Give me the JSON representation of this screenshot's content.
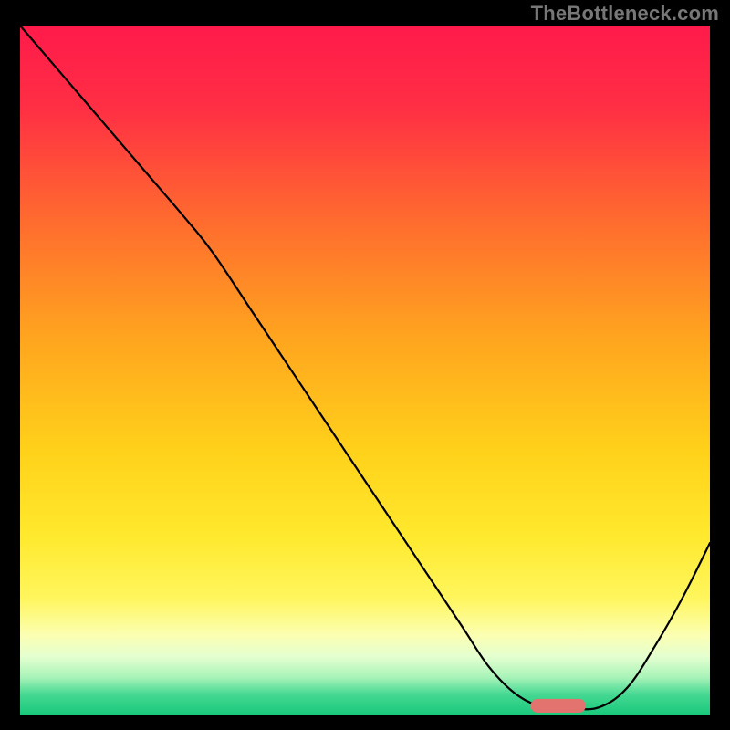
{
  "watermark": "TheBottleneck.com",
  "chart_data": {
    "type": "line",
    "title": "",
    "xlabel": "",
    "ylabel": "",
    "xlim": [
      0,
      100
    ],
    "ylim": [
      0,
      100
    ],
    "background_gradient": {
      "stops": [
        {
          "offset": 0.0,
          "color": "#ff1a4b"
        },
        {
          "offset": 0.12,
          "color": "#ff2f44"
        },
        {
          "offset": 0.28,
          "color": "#ff6a2f"
        },
        {
          "offset": 0.45,
          "color": "#ffa41f"
        },
        {
          "offset": 0.62,
          "color": "#ffd21a"
        },
        {
          "offset": 0.74,
          "color": "#ffe92e"
        },
        {
          "offset": 0.83,
          "color": "#fff65e"
        },
        {
          "offset": 0.885,
          "color": "#fbffb3"
        },
        {
          "offset": 0.915,
          "color": "#e4ffd0"
        },
        {
          "offset": 0.945,
          "color": "#a8f3b8"
        },
        {
          "offset": 0.97,
          "color": "#44d892"
        },
        {
          "offset": 1.0,
          "color": "#18c87a"
        }
      ]
    },
    "series": [
      {
        "name": "bottleneck-curve",
        "color": "#000000",
        "width": 2.2,
        "x": [
          0,
          6,
          12,
          18,
          24,
          28,
          34,
          40,
          46,
          52,
          58,
          64,
          68,
          72,
          76,
          80,
          84,
          88,
          92,
          96,
          100
        ],
        "y": [
          100,
          93,
          86,
          79,
          72,
          67,
          58,
          49,
          40,
          31,
          22,
          13,
          7,
          3,
          1.2,
          1.0,
          1.2,
          4,
          10,
          17,
          25
        ]
      }
    ],
    "marker": {
      "name": "optimal-marker",
      "color": "#e2736f",
      "x_start": 74,
      "x_end": 82,
      "y": 1.4,
      "thickness_pct": 2.0,
      "rx_pct": 1.0
    }
  }
}
